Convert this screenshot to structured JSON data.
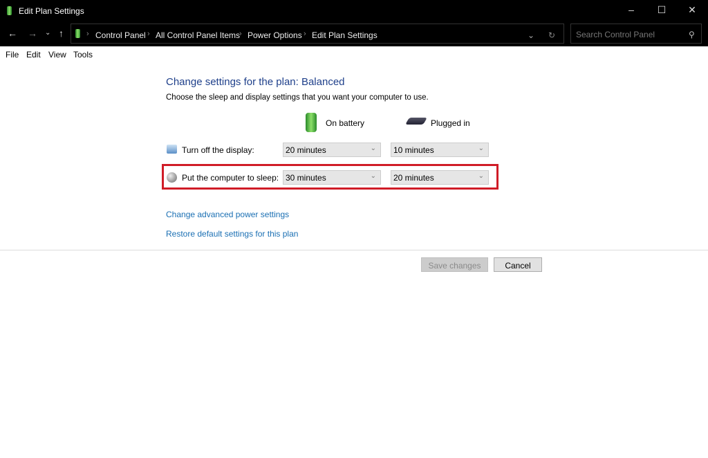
{
  "window": {
    "title": "Edit Plan Settings"
  },
  "nav": {
    "breadcrumbs": [
      "Control Panel",
      "All Control Panel Items",
      "Power Options",
      "Edit Plan Settings"
    ],
    "search_placeholder": "Search Control Panel"
  },
  "menu": [
    "File",
    "Edit",
    "View",
    "Tools"
  ],
  "main": {
    "title": "Change settings for the plan: Balanced",
    "subtitle": "Choose the sleep and display settings that you want your computer to use.",
    "columns": {
      "battery": "On battery",
      "plugged": "Plugged in"
    },
    "rows": [
      {
        "label": "Turn off the display:",
        "battery": "20 minutes",
        "plugged": "10 minutes"
      },
      {
        "label": "Put the computer to sleep:",
        "battery": "30 minutes",
        "plugged": "20 minutes"
      }
    ],
    "links": [
      "Change advanced power settings",
      "Restore default settings for this plan"
    ],
    "save": "Save changes",
    "cancel": "Cancel"
  },
  "colors": {
    "highlight": "#d01c27",
    "title": "#1e3f8a",
    "link": "#1a6fb3"
  }
}
